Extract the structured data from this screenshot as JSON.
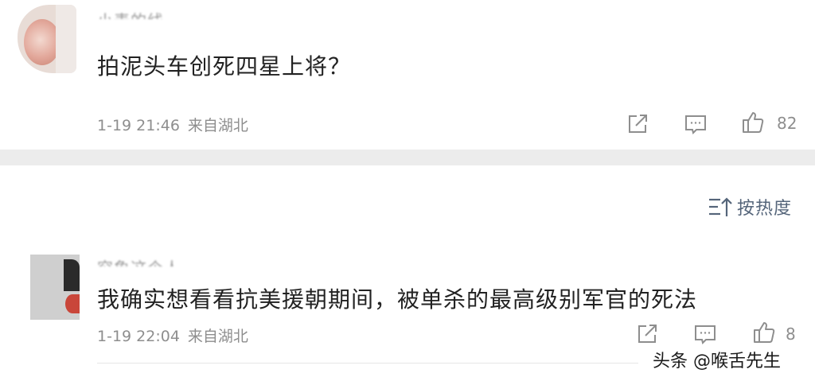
{
  "comments": [
    {
      "username": "小麦的线",
      "text": "拍泥头车创死四星上将？",
      "time": "1-19 21:46",
      "location": "来自湖北",
      "likes": "82"
    },
    {
      "username": "穷象这个人",
      "text": "我确实想看看抗美援朝期间，被单杀的最高级别军官的死法",
      "time": "1-19 22:04",
      "location": "来自湖北",
      "likes": "8"
    }
  ],
  "sort": {
    "label": "按热度"
  },
  "watermark": "头条 @喉舌先生",
  "colors": {
    "text": "#222222",
    "meta": "#8e8e8e",
    "divider": "#ececec",
    "sort": "#55657a"
  },
  "icons": {
    "share": "share-icon",
    "reply": "comment-icon",
    "like": "thumbs-up-icon",
    "sort": "sort-icon"
  }
}
